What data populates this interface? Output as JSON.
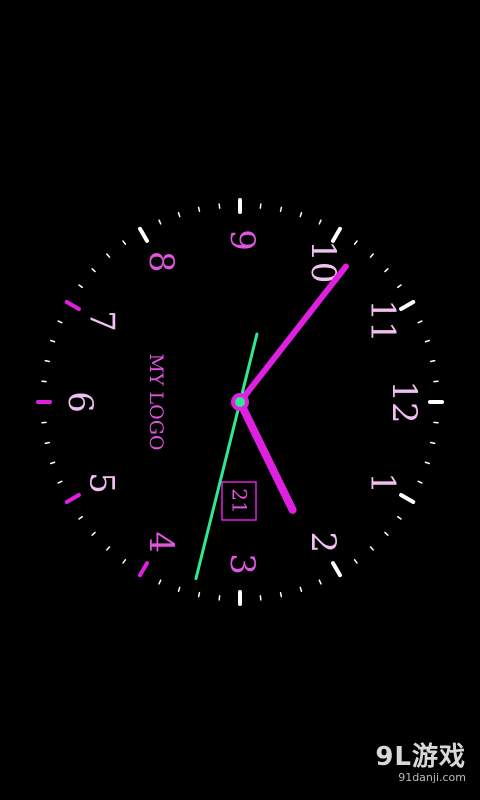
{
  "clock": {
    "numerals": [
      "12",
      "1",
      "2",
      "3",
      "4",
      "5",
      "6",
      "7",
      "8",
      "9",
      "10",
      "11"
    ],
    "logo_text": "MY LOGO",
    "date_day": "21",
    "time": {
      "hour_hand_numeral": "2",
      "minute_hand_numeral": "10",
      "second_hand_numeral": "3"
    },
    "colors": {
      "background": "#000000",
      "accent": "#e020e0",
      "numeral_major": "#f0c0f0",
      "numeral_minor": "#e055e0",
      "second_hand": "#30e890",
      "ticks": "#ffffff"
    }
  },
  "watermark": {
    "brand": "9L游戏",
    "site": "91danji.com"
  }
}
